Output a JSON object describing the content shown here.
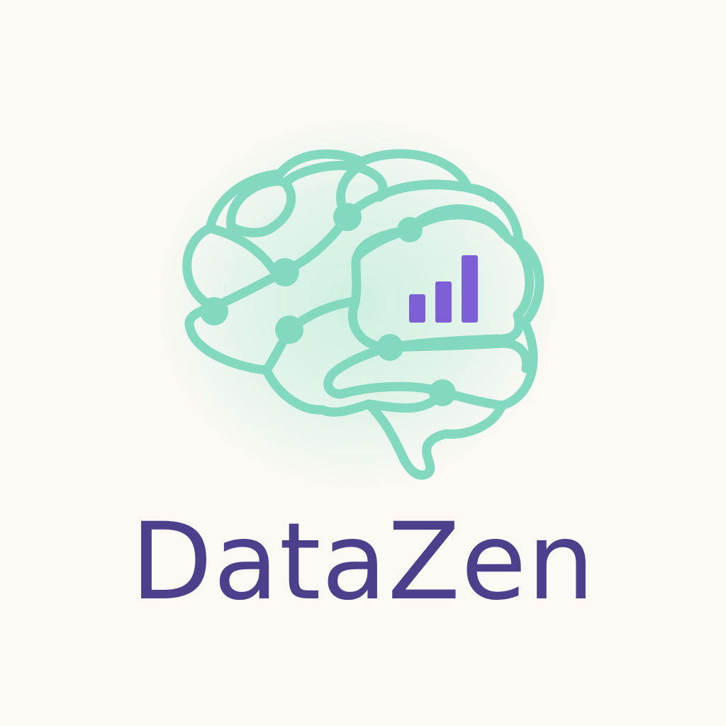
{
  "brand": {
    "name": "DataZen",
    "icon": "brain-bar-chart-icon",
    "colors": {
      "background": "#fcf9f5",
      "brain_outline": "#82d9bf",
      "bars": "#7d5fd6",
      "wordmark": "#4c3f8b"
    }
  }
}
